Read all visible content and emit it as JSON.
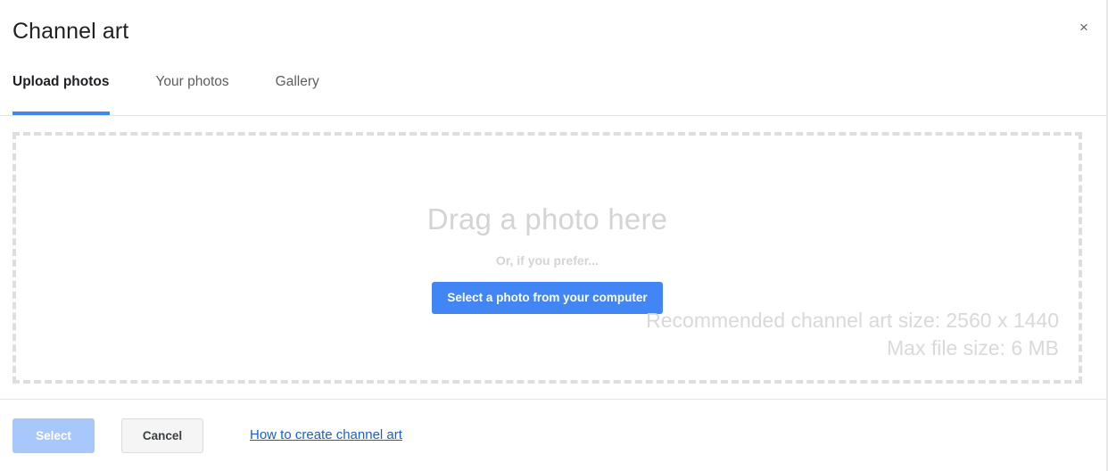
{
  "header": {
    "title": "Channel art",
    "close_label": "×"
  },
  "tabs": [
    {
      "label": "Upload photos",
      "active": true
    },
    {
      "label": "Your photos",
      "active": false
    },
    {
      "label": "Gallery",
      "active": false
    }
  ],
  "dropzone": {
    "headline": "Drag a photo here",
    "subtext": "Or, if you prefer...",
    "button_label": "Select a photo from your computer",
    "hints": [
      "Recommended channel art size: 2560 x 1440",
      "Max file size: 6 MB"
    ]
  },
  "footer": {
    "select_label": "Select",
    "cancel_label": "Cancel",
    "help_link_label": "How to create channel art"
  },
  "colors": {
    "accent_blue": "#4285f4",
    "disabled_blue": "#a8c7fa",
    "link_blue": "#1a5fd6",
    "placeholder_gray": "#d4d4d4",
    "border_gray": "#e4e4e4"
  }
}
